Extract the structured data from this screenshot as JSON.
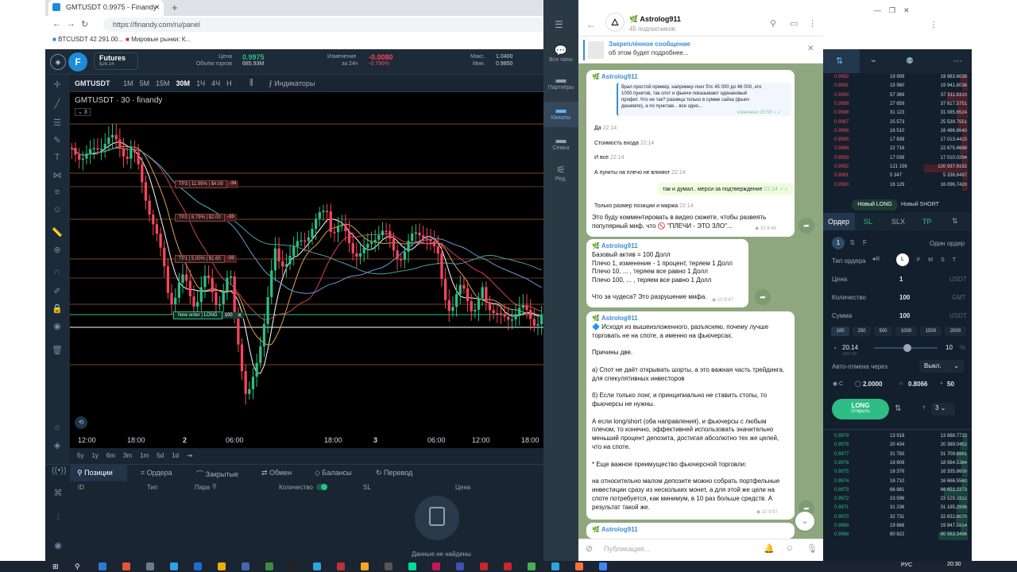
{
  "browser": {
    "tab_title": "GMTUSDT 0.9975 - Finandy",
    "url": "https://finandy.com/ru/panel",
    "bookmarks": [
      "BTCUSDT 42 291.00...",
      "Мировые рынки: К..."
    ]
  },
  "finandy": {
    "market_label": "Futures",
    "market_sub": "$26.14",
    "price_label": "Цена",
    "price_value": "0.9975",
    "volume_label": "Объём торгов",
    "volume_value": "685.93M",
    "change_label": "Изменение",
    "change_sub": "за 24ч",
    "change_value": "-0.0080",
    "change_pct": "-0.796%",
    "max_label": "Макс.",
    "max_value": "1.0400",
    "min_label": "Мин.",
    "min_value": "0.9850",
    "symbol": "GMTUSDT",
    "timeframes": [
      "1М",
      "5М",
      "15М",
      "30М",
      "1Ч",
      "4Ч",
      "Н"
    ],
    "indicators_label": "Индикаторы",
    "chart_title": "GMTUSDT · 30 · finandy",
    "badge_count": "3",
    "tp_labels": [
      {
        "text": "TP3 | 11.99% | $4.08",
        "qty": "-34"
      },
      {
        "text": "TP2 | 8.79% | $2.00",
        "qty": "-33"
      },
      {
        "text": "TP1 | 5.00% | $1.65",
        "qty": "-33"
      }
    ],
    "order_label": "New order | LONG",
    "order_qty": "100",
    "time_axis": [
      "12:00",
      "18:00",
      "2",
      "06:00",
      "12:00",
      "18:00",
      "3",
      "06:00",
      "12:00",
      "18:00"
    ],
    "ranges": [
      "5y",
      "1y",
      "6m",
      "3m",
      "1m",
      "5d",
      "1d"
    ],
    "bottom_tabs": [
      "Позиции",
      "Ордера",
      "Закрытые",
      "Обмен",
      "Балансы",
      "Перевод"
    ],
    "table_headers": [
      "ID",
      "Тип",
      "Пара",
      "Количество",
      "SL",
      "Цена"
    ],
    "empty_text": "Данные не найдены"
  },
  "telegram": {
    "nav": [
      "Все чаты",
      "Партнёры",
      "Каналы",
      "Семья",
      "Ред."
    ],
    "channel_name": "Astrolog911",
    "subscribers": "45 подписчиков",
    "pinned_title": "Закреплённое сообщение",
    "pinned_text": "об этом будет подробнее...",
    "msg1_author": "Astrolog911",
    "msg1_quote": [
      "брал простой пример, например лонг бтс 45 000 до 46 000, это",
      "1000 пунктов, так спот и фьючи показывают одинаковый",
      "профит. Что не так? разница только в сумме сайза (фьюч",
      "дешевле), а по пунктам... все одно..."
    ],
    "msg1_quote_meta": "изменено 20:59",
    "chips": [
      {
        "text": "Да",
        "time": "22:14"
      },
      {
        "text": "Стоимость входа",
        "time": "22:14"
      },
      {
        "text": "И все",
        "time": "22:14"
      },
      {
        "text": "А пункты на плечо не влияют",
        "time": "22:14"
      }
    ],
    "chip_out": {
      "text": "так и думал.. мерси за подтверждение",
      "time": "22:14"
    },
    "chip_last": {
      "text": "Только размер позиции и маржа",
      "time": "22:14"
    },
    "msg1_body": [
      "Это буду комментировать в видео сюжете, чтобы развеять",
      "популярный миф, что 🚫 \"ПЛЕЧИ - ЭТО ЗЛО\"..."
    ],
    "msg1_meta": "10  9:46",
    "msg2_author": "Astrolog911",
    "msg2_lines": [
      "Базовый актив = 100 Долл",
      "Плечо 1, изменение - 1 процент, теряем 1 Долл",
      "Плечо 10, ... , теряем все равно 1 Долл",
      "Плечо 100, ... , теряем все равно 1 Долл",
      "",
      "Что за чудеса? Это разрушение мифа."
    ],
    "msg2_meta": "10  9:47",
    "msg3_author": "Astrolog911",
    "msg3_lines": [
      "🔷 Исходя из вышеизложенного, разъясняю, почему лучше",
      "торговать не на споте, а именно на фьючерсах.",
      "",
      "Причины две.",
      "",
      "а) Спот не даёт открывать шорты, а это важная часть трейдинга,",
      "для спекулятивных инвесторов",
      "",
      "б) Если только лонг, и принципиально не ставить стопы, то",
      "фьючерсы не нужны.",
      "",
      "А если long/short (оба направления), и фьючерсы с любым",
      "плечом, то конечно, эффективней использовать значительно",
      "меньший процент депозита, достигая абсолютно тех же целей,",
      "что на споте.",
      "",
      "* Еще важное преимущество фьючерсной торговли:",
      "",
      "на относительно малом депозите можно собрать портфельные",
      "инвестиции сразу из нескольких монет, а для этой же цели на",
      "споте потребуется, как минимум, в 10 раз больше средств. А",
      "результат такой же."
    ],
    "msg3_meta": "10  9:57",
    "msg4_author": "Astrolog911",
    "input_placeholder": "Публикация..."
  },
  "orderbook": {
    "asks": [
      [
        "0.9992",
        "19 999",
        "19 983.6038"
      ],
      [
        "0.9991",
        "15 960",
        "19 941.8038"
      ],
      [
        "0.9990",
        "57 369",
        "57 311.6310"
      ],
      [
        "0.9989",
        "27 659",
        "37 617.5751"
      ],
      [
        "0.9988",
        "31 123",
        "31 085.6524"
      ],
      [
        "0.9987",
        "25 573",
        "25 539.7551"
      ],
      [
        "0.9986",
        "16 510",
        "16 486.8640"
      ],
      [
        "0.9985",
        "17 839",
        "17 013.4415"
      ],
      [
        "0.9984",
        "22 716",
        "22 675.6688"
      ],
      [
        "0.9983",
        "17 039",
        "17 010.0294"
      ],
      [
        "0.9982",
        "121 156",
        "120 937.9192"
      ],
      [
        "0.9981",
        "5 347",
        "5 336.8487"
      ],
      [
        "0.9980",
        "16 129",
        "16 096.7420"
      ]
    ],
    "new_long": "Новый LONG",
    "new_short": "Новый SHORT",
    "tabs": [
      "Ордер",
      "SL",
      "SLX",
      "TP"
    ],
    "one_order": "Один ордер",
    "order_type_label": "Тип ордера",
    "order_type_opts": [
      "L",
      "F",
      "M",
      "S",
      "T"
    ],
    "price_label": "Цена",
    "price_value": "1",
    "price_unit": "USDT",
    "qty_label": "Количество",
    "qty_value": "100",
    "qty_unit": "GMT",
    "sum_label": "Сумма",
    "sum_value": "100",
    "sum_unit": "USDT",
    "presets": [
      "100",
      "250",
      "500",
      "1000",
      "1500",
      "2000"
    ],
    "margin_value": "20.14",
    "margin_sub": "1007.00",
    "leverage_value": "10",
    "auto_cancel_label": "Авто-отмена через",
    "auto_cancel_value": "Выкл.",
    "c_value": "2.0000",
    "d_value": "0.8066",
    "d_value2": "50",
    "long_btn": "LONG",
    "long_sub": "Открыть",
    "count_value": "3",
    "bids": [
      [
        "0.9979",
        "13 918",
        "13 888.7722"
      ],
      [
        "0.9978",
        "20 434",
        "20 389.0452"
      ],
      [
        "0.9977",
        "31 783",
        "31 709.6991"
      ],
      [
        "0.9976",
        "18 609",
        "18 564.5384"
      ],
      [
        "0.9975",
        "16 376",
        "16 335.8600"
      ],
      [
        "0.9974",
        "16 710",
        "16 666.5560"
      ],
      [
        "0.9973",
        "66 881",
        "66 651.2373"
      ],
      [
        "0.9972",
        "23 596",
        "23 529.3312"
      ],
      [
        "0.9971",
        "31 236",
        "31 185.2996"
      ],
      [
        "0.9970",
        "32 731",
        "32 632.8070"
      ],
      [
        "0.9969",
        "19 866",
        "19 847.5814"
      ],
      [
        "0.9968",
        "80 822",
        "80 563.3496"
      ]
    ]
  },
  "taskbar": {
    "lang": "РУС",
    "time": "20:30"
  },
  "colors": {
    "sell": "#f6465d",
    "buy": "#2ebd85",
    "accent": "#1e8cd6",
    "tg_accent": "#3a8dd6"
  }
}
